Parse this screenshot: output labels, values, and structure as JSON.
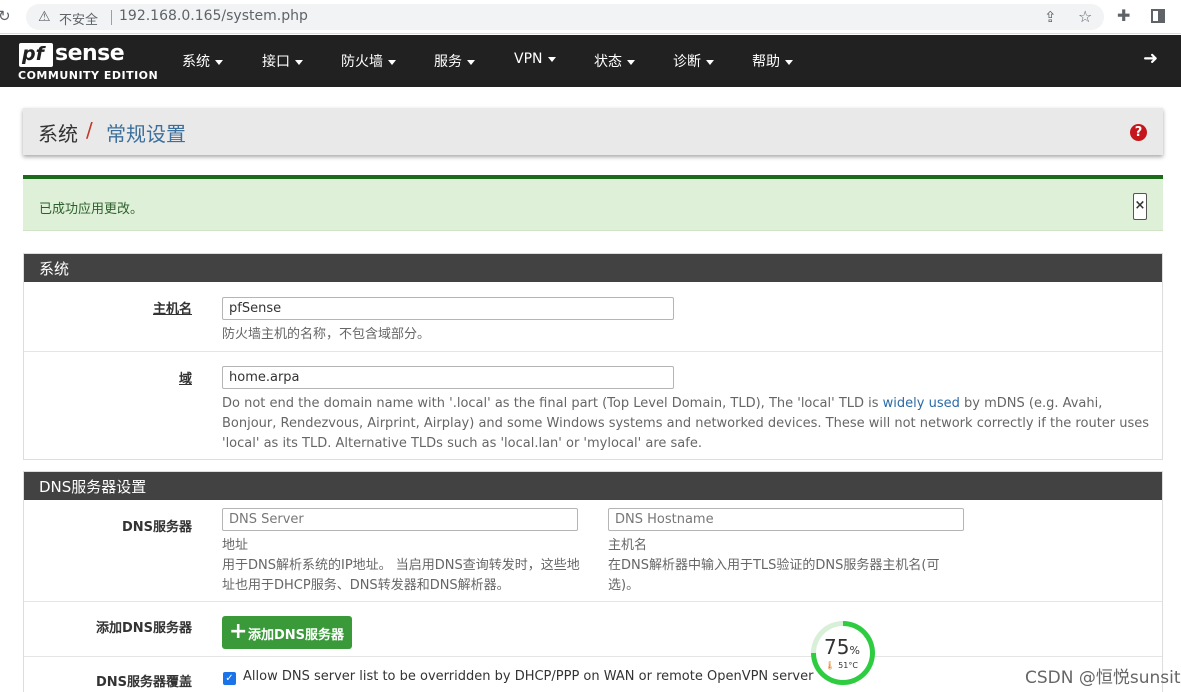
{
  "browser": {
    "insecure_label": "不安全",
    "url": "192.168.0.165/system.php"
  },
  "navbar": {
    "logo_pf": "pf",
    "logo_sense": "sense",
    "logo_edition": "COMMUNITY EDITION",
    "items": [
      "系统",
      "接口",
      "防火墙",
      "服务",
      "VPN",
      "状态",
      "诊断",
      "帮助"
    ]
  },
  "breadcrumb": {
    "parent": "系统",
    "separator": "/",
    "current": "常规设置",
    "help_icon": "?"
  },
  "alert": {
    "message": "已成功应用更改。",
    "close": "×"
  },
  "system_panel": {
    "title": "系统",
    "hostname": {
      "label": "主机名",
      "value": "pfSense",
      "help": "防火墙主机的名称，不包含域部分。"
    },
    "domain": {
      "label": "域",
      "value": "home.arpa",
      "help_1": "Do not end the domain name with '.local' as the final part (Top Level Domain, TLD), The 'local' TLD is ",
      "help_link": "widely used",
      "help_2": " by mDNS (e.g. Avahi, Bonjour, Rendezvous, Airprint, Airplay) and some Windows systems and networked devices. These will not network correctly if the router uses 'local' as its TLD. Alternative TLDs such as 'local.lan' or 'mylocal' are safe."
    }
  },
  "dns_panel": {
    "title": "DNS服务器设置",
    "dns_servers": {
      "label": "DNS服务器",
      "server_placeholder": "DNS Server",
      "hostname_placeholder": "DNS Hostname",
      "server_help_title": "地址",
      "server_help": "用于DNS解析系统的IP地址。 当启用DNS查询转发时，这些地址也用于DHCP服务、DNS转发器和DNS解析器。",
      "hostname_help_title": "主机名",
      "hostname_help": "在DNS解析器中输入用于TLS验证的DNS服务器主机名(可选)。"
    },
    "add_dns": {
      "label": "添加DNS服务器",
      "button": "添加DNS服务器"
    },
    "override": {
      "label": "DNS服务器覆盖",
      "text": "Allow DNS server list to be overridden by DHCP/PPP on WAN or remote OpenVPN server",
      "checked": true
    }
  },
  "gauge": {
    "percent": 75,
    "percent_value": "75",
    "percent_unit": "%",
    "temperature": "51°C",
    "color": "#2ecc40"
  },
  "watermark": "CSDN @恒悦sunsite"
}
